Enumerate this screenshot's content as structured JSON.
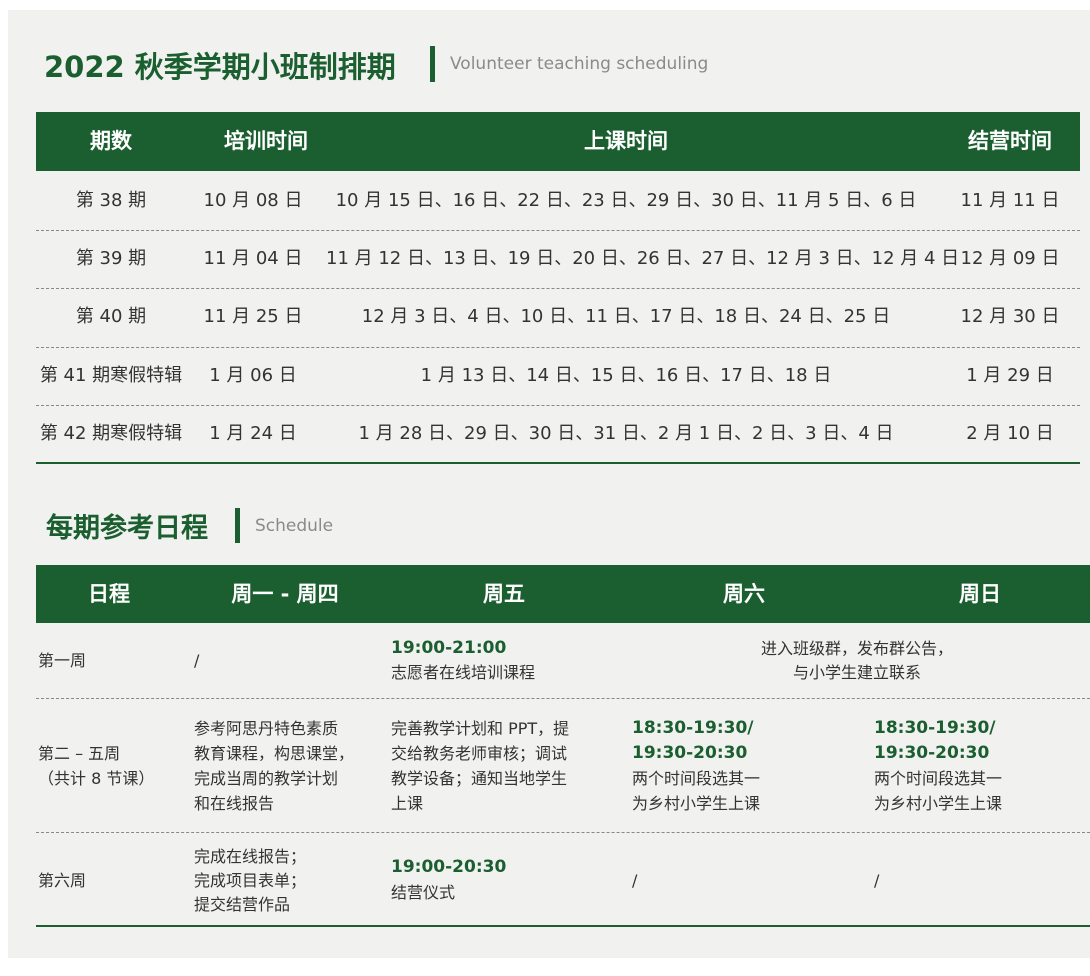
{
  "section1": {
    "title": "2022 秋季学期小班制排期",
    "subtitle": "Volunteer teaching scheduling",
    "headers": [
      "期数",
      "培训时间",
      "上课时间",
      "结营时间"
    ],
    "rows": [
      [
        "第 38 期",
        "10 月 08 日",
        "10 月 15 日、16 日、22 日、23 日、29 日、30 日、11 月 5 日、6 日",
        "11 月 11 日"
      ],
      [
        "第 39 期",
        "11 月 04 日",
        "11 月 12 日、13 日、19 日、20 日、26 日、27 日、12 月 3 日、12 月 4 日",
        "12 月 09 日"
      ],
      [
        "第 40 期",
        "11 月 25 日",
        "12 月 3 日、4 日、10 日、11 日、17 日、18 日、24 日、25 日",
        "12 月 30 日"
      ],
      [
        "第 41 期寒假特辑",
        "1 月 06 日",
        "1 月 13 日、14 日、15 日、16 日、17 日、18 日",
        "1 月 29 日"
      ],
      [
        "第 42 期寒假特辑",
        "1 月 24 日",
        "1 月 28 日、29 日、30 日、31 日、2 月 1 日、2 日、3 日、4 日",
        "2 月 10 日"
      ]
    ]
  },
  "section2": {
    "title": "每期参考日程",
    "subtitle": "Schedule",
    "headers": [
      "日程",
      "周一 - 周四",
      "周五",
      "周六",
      "周日"
    ],
    "week1": {
      "label": "第一周",
      "mon_thu": "/",
      "fri_time": "19:00-21:00",
      "fri_text": "志愿者在线培训课程",
      "weekend_line1": "进入班级群，发布群公告，",
      "weekend_line2": "与小学生建立联系"
    },
    "week2_5": {
      "label": "第二 – 五周",
      "sublabel": "（共计 8 节课）",
      "mon_thu": [
        "参考阿思丹特色素质",
        "教育课程，构思课堂，",
        "完成当周的教学计划",
        "和在线报告"
      ],
      "fri": [
        "完善教学计划和 PPT，提",
        "交给教务老师审核；调试",
        "教学设备；通知当地学生",
        "上课"
      ],
      "sat_time1": "18:30-19:30/",
      "sat_time2": "19:30-20:30",
      "sat_text": [
        "两个时间段选其一",
        "为乡村小学生上课"
      ],
      "sun_time1": "18:30-19:30/",
      "sun_time2": "19:30-20:30",
      "sun_text": [
        "两个时间段选其一",
        "为乡村小学生上课"
      ]
    },
    "week6": {
      "label": "第六周",
      "mon_thu": [
        "完成在线报告；",
        "完成项目表单；",
        "提交结营作品"
      ],
      "fri_time": "19:00-20:30",
      "fri_text": "结营仪式",
      "sat": "/",
      "sun": "/"
    }
  }
}
